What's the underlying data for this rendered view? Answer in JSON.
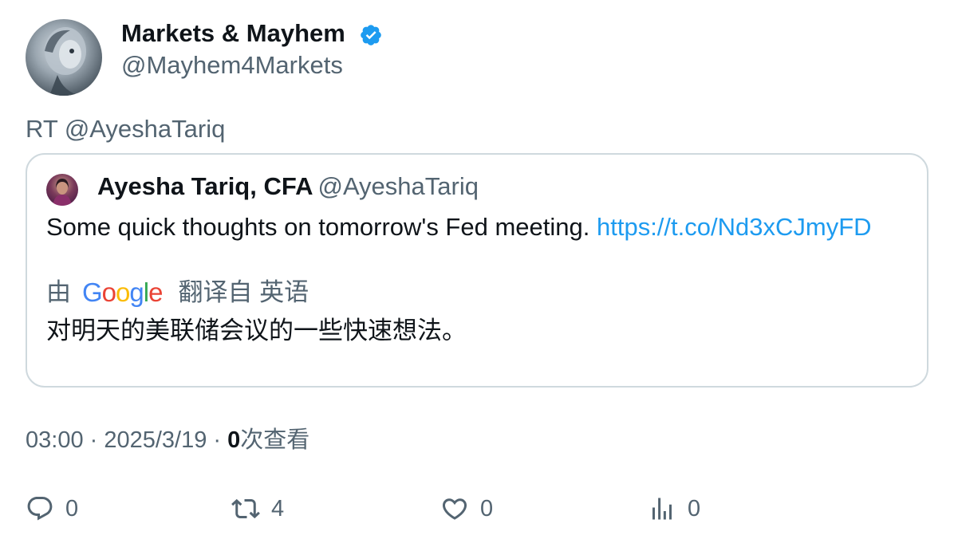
{
  "author": {
    "display_name": "Markets & Mayhem",
    "handle": "@Mayhem4Markets",
    "verified_icon": "verified-badge-icon"
  },
  "retweet_line": "RT @AyeshaTariq",
  "quoted": {
    "name": "Ayesha Tariq, CFA",
    "handle": "@AyeshaTariq",
    "text": "Some quick thoughts on tomorrow's Fed meeting. ",
    "link": "https://t.co/Nd3xCJmyFD",
    "translation_by": "由",
    "translation_provider": "Google",
    "translation_from": "翻译自 英语",
    "translated_text": "对明天的美联储会议的一些快速想法。"
  },
  "meta": {
    "time": "03:00",
    "sep1": " · ",
    "date": "2025/3/19",
    "sep2": " · ",
    "views_count": "0",
    "views_label": "次查看"
  },
  "actions": {
    "reply_count": "0",
    "retweet_count": "4",
    "like_count": "0",
    "views_count": "0"
  },
  "colors": {
    "accent": "#1d9bf0",
    "secondary_text": "#536471",
    "border": "#cfd9de"
  }
}
